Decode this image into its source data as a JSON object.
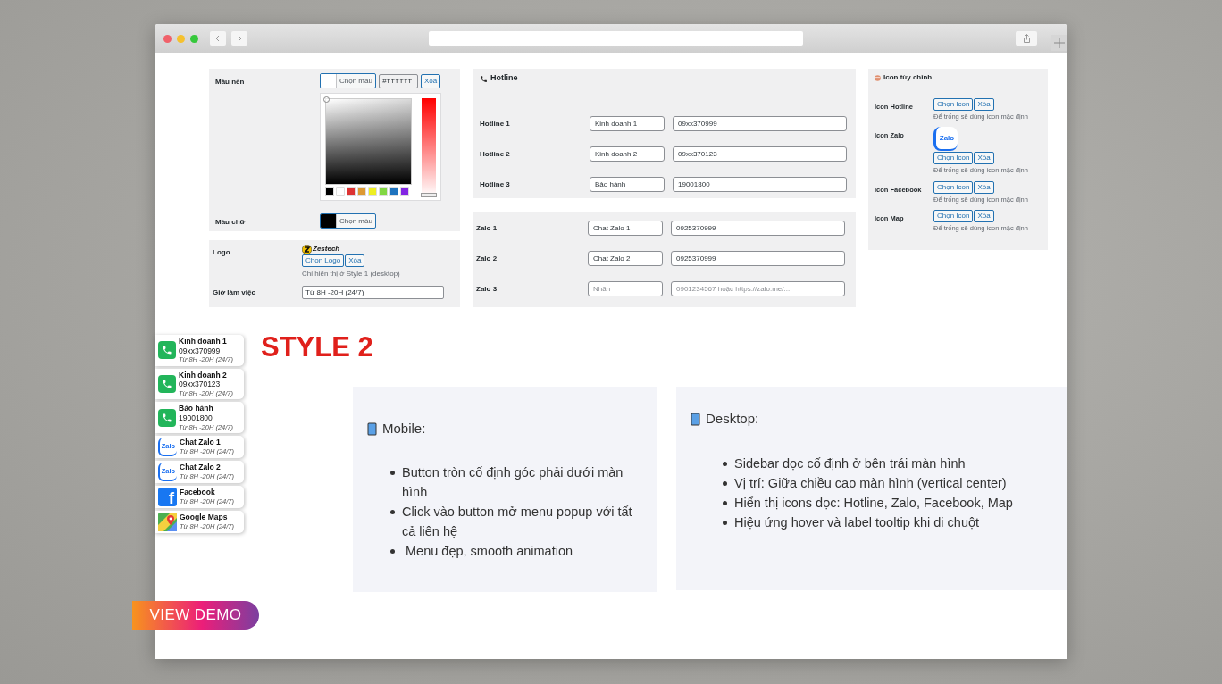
{
  "colors": [
    {
      "label": "Màu nền",
      "color": "#ffffff",
      "button": "Chọn màu",
      "value": "#ffffff",
      "clear": "Xóa",
      "expanded": true,
      "swatches": [
        {
          "color": "#000000"
        },
        {
          "color": "#ffffff"
        },
        {
          "color": "#dd3333"
        },
        {
          "color": "#dd9933"
        },
        {
          "color": "#eeee22"
        },
        {
          "color": "#81d742"
        },
        {
          "color": "#1e73be"
        },
        {
          "color": "#8224e3"
        }
      ]
    },
    {
      "label": "Màu chữ",
      "color": "#000000",
      "button": "Chọn màu",
      "expanded": false
    }
  ],
  "logo": {
    "label": "Logo",
    "brand": "Zestech",
    "choose": "Chọn Logo",
    "clear": "Xóa",
    "hint": "Chỉ hiển thị ở Style 1 (desktop)"
  },
  "hours": {
    "label": "Giờ làm việc",
    "value": "Từ 8H -20H (24/7)"
  },
  "hotline": {
    "title": "Hotline",
    "rows": [
      {
        "label": "Hotline 1",
        "name": {
          "value": "Kinh doanh 1"
        },
        "phone": {
          "value": "09xx370999"
        }
      },
      {
        "label": "Hotline 2",
        "name": {
          "value": "Kinh doanh 2"
        },
        "phone": {
          "value": "09xx370123"
        }
      },
      {
        "label": "Hotline 3",
        "name": {
          "value": "Bảo hành"
        },
        "phone": {
          "value": "19001800"
        }
      }
    ]
  },
  "zalo": {
    "rows": [
      {
        "label": "Zalo 1",
        "name": {
          "value": "Chat Zalo 1"
        },
        "phone": {
          "value": "0925370999"
        }
      },
      {
        "label": "Zalo 2",
        "name": {
          "value": "Chat Zalo 2"
        },
        "phone": {
          "value": "0925370999"
        }
      },
      {
        "label": "Zalo 3",
        "name": {
          "placeholder": "Nhãn"
        },
        "phone": {
          "placeholder": "0901234567 hoặc https://zalo.me/..."
        }
      }
    ]
  },
  "icons": {
    "title": "Icon tùy chỉnh",
    "rows": [
      {
        "label": "Icon Hotline",
        "kind": "default",
        "choose": "Chọn Icon",
        "clear": "Xóa",
        "hint": "Để trống sẽ dùng icon mặc định"
      },
      {
        "label": "Icon Zalo",
        "kind": "zalo",
        "preview": "Zalo",
        "choose": "Chọn Icon",
        "clear": "Xóa",
        "hint": "Để trống sẽ dùng icon mặc định"
      },
      {
        "label": "Icon Facebook",
        "kind": "default",
        "choose": "Chọn Icon",
        "clear": "Xóa",
        "hint": "Để trống sẽ dùng icon mặc định"
      },
      {
        "label": "Icon Map",
        "kind": "default",
        "choose": "Chọn Icon",
        "clear": "Xóa",
        "hint": "Để trống sẽ dùng icon mặc định"
      }
    ]
  },
  "style_title": "STYLE 2",
  "contacts": [
    {
      "kind": "phone",
      "name": "Kinh doanh 1",
      "phone": "09xx370999",
      "hours": "Từ 8H -20H (24/7)"
    },
    {
      "kind": "phone",
      "name": "Kinh doanh 2",
      "phone": "09xx370123",
      "hours": "Từ 8H -20H (24/7)"
    },
    {
      "kind": "phone",
      "name": "Bảo hành",
      "phone": "19001800",
      "hours": "Từ 8H -20H (24/7)"
    },
    {
      "kind": "zalo",
      "icon_text": "Zalo",
      "name": "Chat Zalo 1",
      "hours": "Từ 8H -20H (24/7)"
    },
    {
      "kind": "zalo",
      "icon_text": "Zalo",
      "name": "Chat Zalo 2",
      "hours": "Từ 8H -20H (24/7)"
    },
    {
      "kind": "facebook",
      "icon_text": "f",
      "name": "Facebook",
      "hours": "Từ 8H -20H (24/7)"
    },
    {
      "kind": "maps",
      "name": "Google Maps",
      "hours": "Từ 8H -20H (24/7)"
    }
  ],
  "notes": [
    {
      "title": "Mobile:",
      "items": [
        "Button tròn cố định góc phải dưới màn hình",
        "Click vào button mở menu popup với tất cả liên hệ",
        " Menu đẹp, smooth animation"
      ]
    },
    {
      "title": "Desktop:",
      "items": [
        "Sidebar dọc cố định ở bên trái màn hình",
        "Vị trí: Giữa chiều cao màn hình (vertical center)",
        "Hiển thị icons dọc: Hotline, Zalo, Facebook, Map",
        "Hiệu ứng hover và label tooltip khi di chuột"
      ]
    }
  ],
  "demo_button": "VIEW DEMO"
}
